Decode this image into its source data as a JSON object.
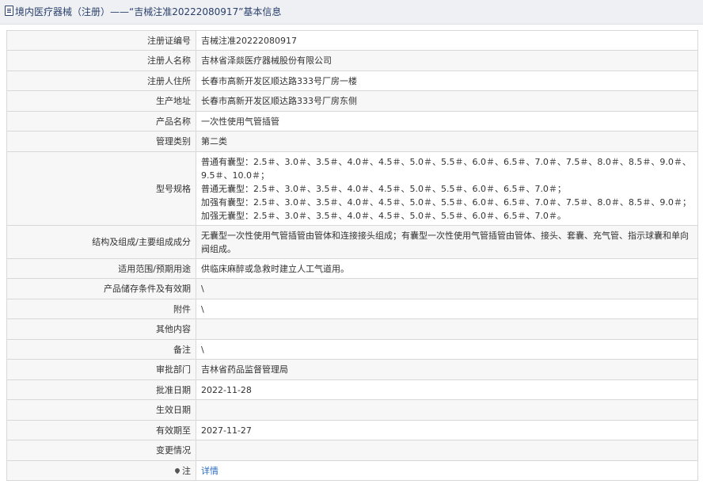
{
  "title": "境内医疗器械（注册）——“吉械注准20222080917”基本信息",
  "rows": [
    {
      "label": "注册证编号",
      "value": "吉械注准20222080917"
    },
    {
      "label": "注册人名称",
      "value": "吉林省泽燚医疗器械股份有限公司"
    },
    {
      "label": "注册人住所",
      "value": "长春市高新开发区顺达路333号厂房一楼"
    },
    {
      "label": "生产地址",
      "value": "长春市高新开发区顺达路333号厂房东侧"
    },
    {
      "label": "产品名称",
      "value": "一次性使用气管插管"
    },
    {
      "label": "管理类别",
      "value": "第二类"
    },
    {
      "label": "型号规格",
      "lines": [
        "普通有囊型：2.5＃、3.0＃、3.5＃、4.0＃、4.5＃、5.0＃、5.5＃、6.0＃、6.5＃、7.0＃、7.5＃、8.0＃、8.5＃、9.0＃、9.5＃、10.0＃；",
        "普通无囊型：2.5＃、3.0＃、3.5＃、4.0＃、4.5＃、5.0＃、5.5＃、6.0＃、6.5＃、7.0＃；",
        "加强有囊型：2.5＃、3.0＃、3.5＃、4.0＃、4.5＃、5.0＃、5.5＃、6.0＃、6.5＃、7.0＃、7.5＃、8.0＃、8.5＃、9.0＃；",
        "加强无囊型：2.5＃、3.0＃、3.5＃、4.0＃、4.5＃、5.0＃、5.5＃、6.0＃、6.5＃、7.0＃。"
      ]
    },
    {
      "label": "结构及组成/主要组成成分",
      "value": "无囊型一次性使用气管插管由管体和连接接头组成；有囊型一次性使用气管插管由管体、接头、套囊、充气管、指示球囊和单向阀组成。"
    },
    {
      "label": "适用范围/预期用途",
      "value": "供临床麻醉或急救时建立人工气道用。"
    },
    {
      "label": "产品储存条件及有效期",
      "value": "\\"
    },
    {
      "label": "附件",
      "value": "\\"
    },
    {
      "label": "其他内容",
      "value": ""
    },
    {
      "label": "备注",
      "value": "\\"
    },
    {
      "label": "审批部门",
      "value": "吉林省药品监督管理局"
    },
    {
      "label": "批准日期",
      "value": "2022-11-28"
    },
    {
      "label": "生效日期",
      "value": ""
    },
    {
      "label": "有效期至",
      "value": "2027-11-27"
    },
    {
      "label": "变更情况",
      "value": ""
    },
    {
      "label": "注",
      "value": "详情"
    }
  ]
}
